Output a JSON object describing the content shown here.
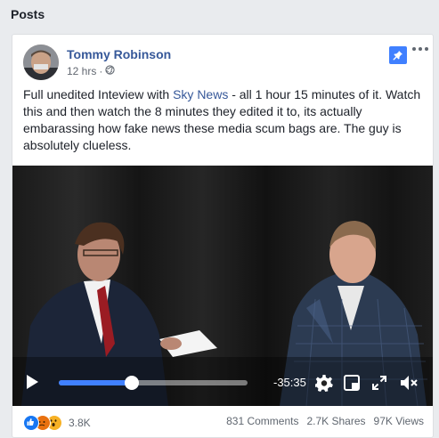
{
  "section_title": "Posts",
  "post": {
    "author": "Tommy Robinson",
    "time": "12 hrs",
    "text_before": "Full unedited Inteview with ",
    "link_text": "Sky News",
    "text_after": " - all 1 hour 15 minutes of it. Watch this and then watch the 8 minutes they edited it to, its actually embarassing how fake news these media scum bags are. The guy is absolutely clueless."
  },
  "video": {
    "time_remaining": "-35:35",
    "progress": 0.386
  },
  "footer": {
    "reaction_count": "3.8K",
    "comments": "831 Comments",
    "shares": "2.7K Shares",
    "views": "97K Views"
  },
  "icons": {
    "privacy": "globe-icon",
    "pin": "pin-icon",
    "more": "more-options-icon",
    "play": "play-icon",
    "settings": "gear-icon",
    "pip": "picture-in-picture-icon",
    "fullscreen": "fullscreen-icon",
    "volume": "volume-muted-icon"
  },
  "colors": {
    "link": "#365899",
    "pin_bg": "#4080ff",
    "progress": "#4080ff",
    "like": "#1877f2",
    "angry": "#e9710f",
    "wow": "#f7b125"
  }
}
